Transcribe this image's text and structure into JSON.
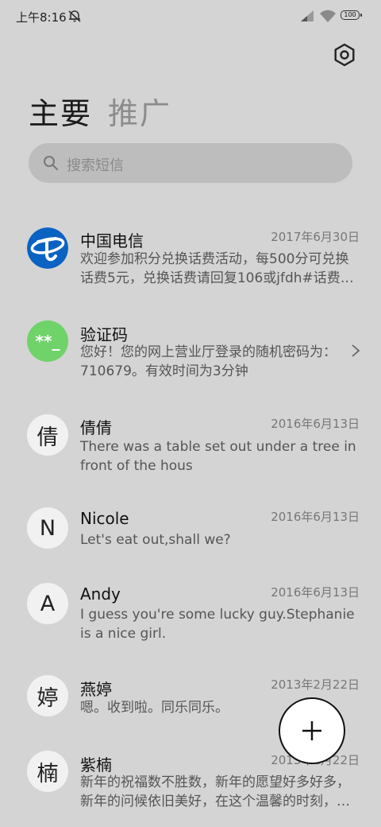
{
  "status": {
    "time": "上午8:16",
    "battery": "100"
  },
  "tabs": {
    "main": "主要",
    "promo": "推广"
  },
  "search": {
    "placeholder": "搜索短信"
  },
  "messages": [
    {
      "name": "中国电信",
      "date": "2017年6月30日",
      "preview": "欢迎参加积分兑换话费活动，每500分可兑换话费5元，兑换话费请回复106或jfdh#话费…",
      "avatar": "telecom-logo"
    },
    {
      "name": "验证码",
      "date": "",
      "preview": "您好！您的网上营业厅登录的随机密码为：710679。有效时间为3分钟",
      "avatar": "**_"
    },
    {
      "name": "倩倩",
      "date": "2016年6月13日",
      "preview": "There was a table set out under a tree in front of the hous",
      "avatar": "倩"
    },
    {
      "name": "Nicole",
      "date": "2016年6月13日",
      "preview": "Let's eat out,shall we?",
      "avatar": "N"
    },
    {
      "name": "Andy",
      "date": "2016年6月13日",
      "preview": "I guess you're some lucky guy.Stephanie is a nice girl.",
      "avatar": "A"
    },
    {
      "name": "燕婷",
      "date": "2013年2月22日",
      "preview": "嗯。收到啦。同乐同乐。",
      "avatar": "婷"
    },
    {
      "name": "紫楠",
      "date": "2013年2月22日",
      "preview": "新年的祝福数不胜数，新年的愿望好多好多，新年的问候依旧美好，在这个温馨的时刻，…",
      "avatar": "楠"
    }
  ],
  "colors": {
    "telecom_blue": "#0a62c2",
    "verify_green": "#6fd36a"
  }
}
